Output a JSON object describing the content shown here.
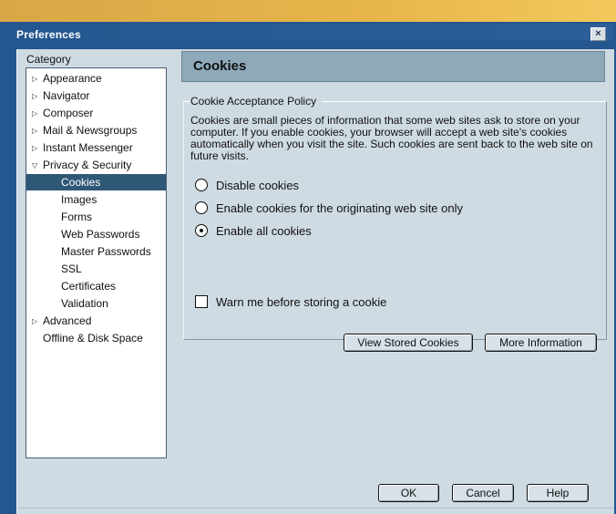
{
  "window": {
    "title": "Preferences",
    "close_glyph": "×"
  },
  "category": {
    "label": "Category",
    "items": [
      {
        "label": "Appearance",
        "expandable": true
      },
      {
        "label": "Navigator",
        "expandable": true
      },
      {
        "label": "Composer",
        "expandable": true
      },
      {
        "label": "Mail & Newsgroups",
        "expandable": true
      },
      {
        "label": "Instant Messenger",
        "expandable": true
      },
      {
        "label": "Privacy & Security",
        "expanded": true
      },
      {
        "label": "Cookies",
        "selected": true
      },
      {
        "label": "Images"
      },
      {
        "label": "Forms"
      },
      {
        "label": "Web Passwords"
      },
      {
        "label": "Master Passwords"
      },
      {
        "label": "SSL"
      },
      {
        "label": "Certificates"
      },
      {
        "label": "Validation"
      },
      {
        "label": "Advanced",
        "expandable": true
      },
      {
        "label": "Offline & Disk Space"
      }
    ]
  },
  "panel": {
    "title": "Cookies",
    "policy_title": "Cookie Acceptance Policy",
    "description": "Cookies are small pieces of information that some web sites ask to store on your computer. If you enable cookies, your browser will accept a web site's cookies automatically when you visit the site. Such cookies are sent back to the web site on future visits.",
    "options": [
      {
        "label": "Disable cookies",
        "selected": false
      },
      {
        "label": "Enable cookies for the originating web site only",
        "selected": false
      },
      {
        "label": "Enable all cookies",
        "selected": true
      }
    ],
    "warn_label": "Warn me before storing a cookie",
    "view_button": "View Stored Cookies",
    "more_button": "More Information"
  },
  "footer": {
    "ok": "OK",
    "cancel": "Cancel",
    "help": "Help"
  }
}
